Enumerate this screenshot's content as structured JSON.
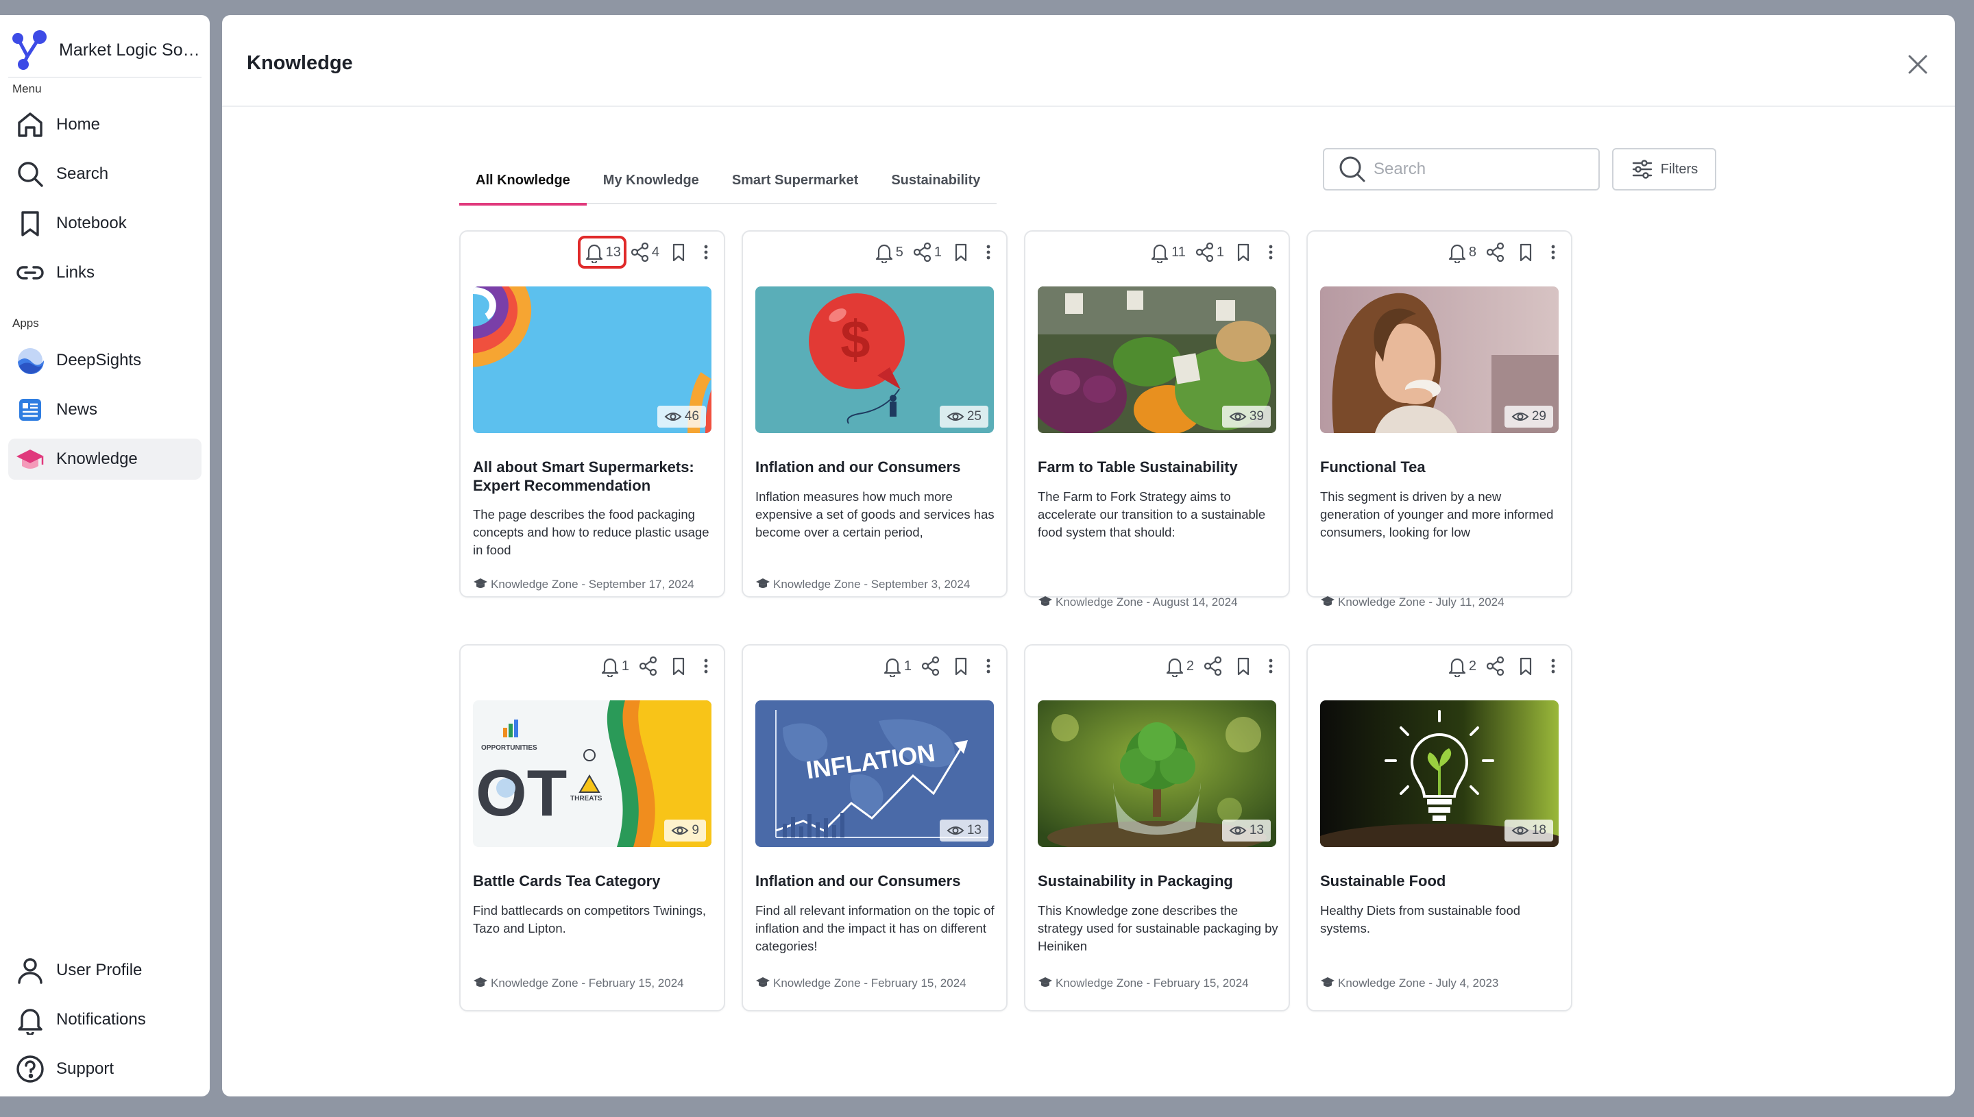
{
  "app": {
    "name": "Market Logic Sof...",
    "brand_color": "#3d4be6"
  },
  "sidebar": {
    "menu_label": "Menu",
    "apps_label": "Apps",
    "menu_items": [
      {
        "label": "Home",
        "icon": "home-icon"
      },
      {
        "label": "Search",
        "icon": "search-icon"
      },
      {
        "label": "Notebook",
        "icon": "bookmark-icon"
      },
      {
        "label": "Links",
        "icon": "link-icon"
      }
    ],
    "app_items": [
      {
        "label": "DeepSights",
        "icon": "deepsights-icon"
      },
      {
        "label": "News",
        "icon": "news-icon"
      },
      {
        "label": "Knowledge",
        "icon": "knowledge-icon",
        "active": true
      }
    ],
    "bottom_items": [
      {
        "label": "User Profile",
        "icon": "user-icon"
      },
      {
        "label": "Notifications",
        "icon": "bell-icon"
      },
      {
        "label": "Support",
        "icon": "help-icon"
      }
    ]
  },
  "modal": {
    "title": "Knowledge",
    "tabs": [
      {
        "label": "All Knowledge",
        "active": true
      },
      {
        "label": "My Knowledge"
      },
      {
        "label": "Smart Supermarket"
      },
      {
        "label": "Sustainability"
      }
    ],
    "search": {
      "placeholder": "Search",
      "value": ""
    },
    "filters_label": "Filters",
    "accent_color": "#e0397c"
  },
  "cards": [
    {
      "title": "All about Smart Supermarkets: Expert Recommendation",
      "description": "The page describes the food packaging concepts and how to reduce plastic usage in food",
      "meta": "Knowledge Zone - September 17, 2024",
      "notifications": "13",
      "shares": "4",
      "views": "46",
      "image": "rainbow-illustration",
      "highlighted": true
    },
    {
      "title": "Inflation and our Consumers",
      "description": "Inflation measures how much more expensive a set of goods and services has become over a certain period,",
      "meta": "Knowledge Zone - September 3, 2024",
      "notifications": "5",
      "shares": "1",
      "views": "25",
      "image": "dollar-balloon-illustration"
    },
    {
      "title": "Farm to Table Sustainability",
      "description": "The Farm to Fork Strategy aims to accelerate our transition to a sustainable food system that should:",
      "meta": "Knowledge Zone - August 14, 2024",
      "notifications": "11",
      "shares": "1",
      "views": "39",
      "image": "vegetable-market-photo"
    },
    {
      "title": "Functional Tea",
      "description": "This segment is driven by a new generation of younger and more informed consumers, looking for low",
      "meta": "Knowledge Zone - July 11, 2024",
      "notifications": "8",
      "shares": "",
      "views": "29",
      "image": "woman-drinking-tea-photo"
    },
    {
      "title": "Battle Cards Tea Category",
      "description": "Find battlecards on competitors Twinings, Tazo and Lipton.",
      "meta": "Knowledge Zone - February 15, 2024",
      "notifications": "1",
      "shares": "",
      "views": "9",
      "image": "swot-illustration",
      "image_text": [
        "OT",
        "OPPORTUNITIES",
        "THREATS"
      ]
    },
    {
      "title": "Inflation and our Consumers",
      "description": "Find all relevant information on the topic of inflation and the impact it has on different categories!",
      "meta": "Knowledge Zone - February 15, 2024",
      "notifications": "1",
      "shares": "",
      "views": "13",
      "image": "inflation-chart-illustration",
      "image_text": [
        "INFLATION"
      ]
    },
    {
      "title": "Sustainability in Packaging",
      "description": "This Knowledge zone describes the strategy used for sustainable packaging by Heiniken",
      "meta": "Knowledge Zone - February 15, 2024",
      "notifications": "2",
      "shares": "",
      "views": "13",
      "image": "tree-in-glass-photo"
    },
    {
      "title": "Sustainable Food",
      "description": "Healthy Diets from sustainable food systems.",
      "meta": "Knowledge Zone - July 4, 2023",
      "notifications": "2",
      "shares": "",
      "views": "18",
      "image": "lightbulb-sprout-photo"
    }
  ]
}
